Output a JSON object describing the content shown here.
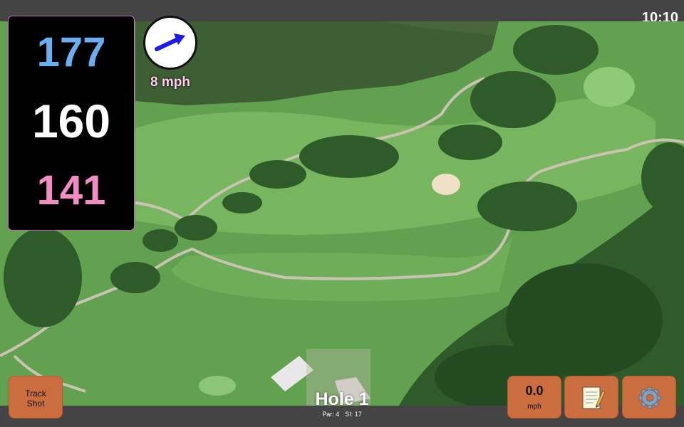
{
  "status_bar": {
    "time": "10:10"
  },
  "distances": {
    "back": "177",
    "center": "160",
    "front": "141"
  },
  "wind": {
    "speed": "8 mph",
    "icon": "wind-direction-arrow-icon"
  },
  "hole": {
    "title": "Hole 1",
    "par": "Par: 4",
    "stroke_index": "SI: 17"
  },
  "buttons": {
    "track_shot_line1": "Track",
    "track_shot_line2": "Shot",
    "speed_value": "0.0",
    "speed_unit": "mph",
    "notes_icon": "notepad-icon",
    "settings_icon": "gear-icon"
  },
  "colors": {
    "back_distance": "#6ab0f0",
    "center_distance": "#ffffff",
    "front_distance": "#f28cc4",
    "button_orange": "#cc6d40",
    "wind_arrow": "#1a1aee"
  }
}
